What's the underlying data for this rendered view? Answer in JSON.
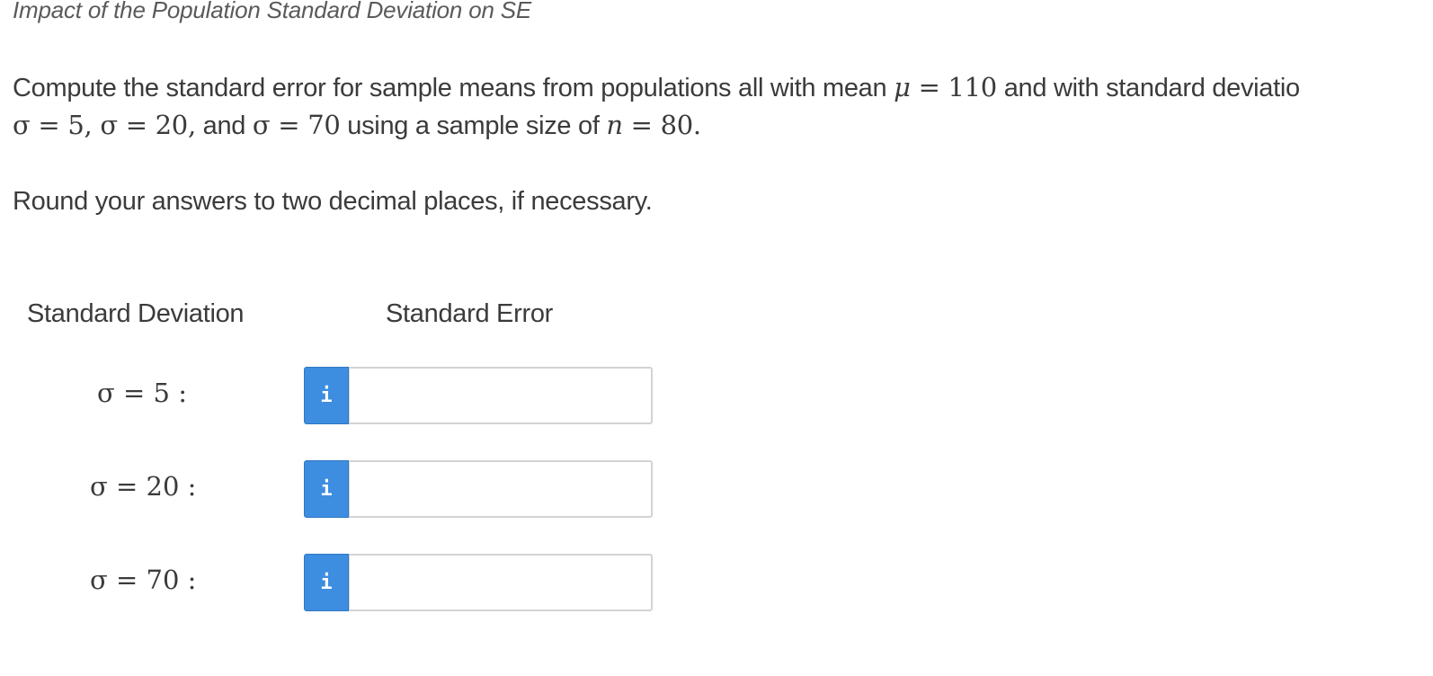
{
  "title": "Impact of the Population Standard Deviation on SE",
  "problem": {
    "line1_text": "Compute the standard error for sample means from populations all with mean ",
    "mu_symbol": "μ",
    "mu_equals": " = 110",
    "line1_tail": " and with standard deviatio",
    "line2_s1": "σ = 5, σ = 20,",
    "line2_and": " and ",
    "line2_s3": "σ = 70",
    "line2_mid": " using a sample size of ",
    "n_symbol": "n",
    "n_value": " = 80.",
    "rounding": "Round your answers to two decimal places, if necessary."
  },
  "table": {
    "col_sd": "Standard Deviation",
    "col_se": "Standard Error",
    "rows": [
      {
        "label": "σ = 5 :",
        "value": "",
        "info_label": "i"
      },
      {
        "label": "σ = 20 :",
        "value": "",
        "info_label": "i"
      },
      {
        "label": "σ = 70 :",
        "value": "",
        "info_label": "i"
      }
    ]
  },
  "colors": {
    "info_button": "#3d8de0",
    "text": "#3b3b3b"
  }
}
